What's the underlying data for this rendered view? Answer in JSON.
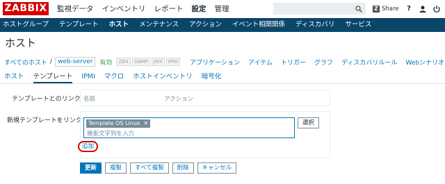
{
  "logo": "ZABBIX",
  "main_menu": [
    {
      "label": "監視データ",
      "active": false
    },
    {
      "label": "インベントリ",
      "active": false
    },
    {
      "label": "レポート",
      "active": false
    },
    {
      "label": "設定",
      "active": true
    },
    {
      "label": "管理",
      "active": false
    }
  ],
  "topbar": {
    "share_label": "Share",
    "help": "?"
  },
  "sub_menu": [
    {
      "label": "ホストグループ",
      "active": false
    },
    {
      "label": "テンプレート",
      "active": false
    },
    {
      "label": "ホスト",
      "active": true
    },
    {
      "label": "メンテナンス",
      "active": false
    },
    {
      "label": "アクション",
      "active": false
    },
    {
      "label": "イベント相関関係",
      "active": false
    },
    {
      "label": "ディスカバリ",
      "active": false
    },
    {
      "label": "サービス",
      "active": false
    }
  ],
  "page_title": "ホスト",
  "host_nav": {
    "all_hosts": "すべてのホスト",
    "separator": "/",
    "host": "web-server",
    "status": "有効",
    "badges": [
      "ZBX",
      "SNMP",
      "JMX",
      "IPMI"
    ],
    "links": [
      "アプリケーション",
      "アイテム",
      "トリガー",
      "グラフ",
      "ディスカバリルール",
      "Webシナリオ"
    ]
  },
  "tabs": [
    {
      "label": "ホスト",
      "active": false
    },
    {
      "label": "テンプレート",
      "active": true
    },
    {
      "label": "IPMI",
      "active": false
    },
    {
      "label": "マクロ",
      "active": false
    },
    {
      "label": "ホストインベントリ",
      "active": false
    },
    {
      "label": "暗号化",
      "active": false
    }
  ],
  "form": {
    "linked_label": "テンプレートとのリンク",
    "col_name": "名前",
    "col_action": "アクション",
    "new_link_label": "新規テンプレートをリンク",
    "chip": "Template OS Linux",
    "placeholder": "検索文字列を入力",
    "select_button": "選択",
    "add_link": "追加"
  },
  "buttons": {
    "update": "更新",
    "clone": "複製",
    "full_clone": "すべて複製",
    "delete": "削除",
    "cancel": "キャンセル"
  },
  "colors": {
    "accent": "#0275b8",
    "nav_bg": "#0a466a",
    "logo_bg": "#d40000",
    "status_green": "#429e47",
    "highlight": "#d40000"
  }
}
